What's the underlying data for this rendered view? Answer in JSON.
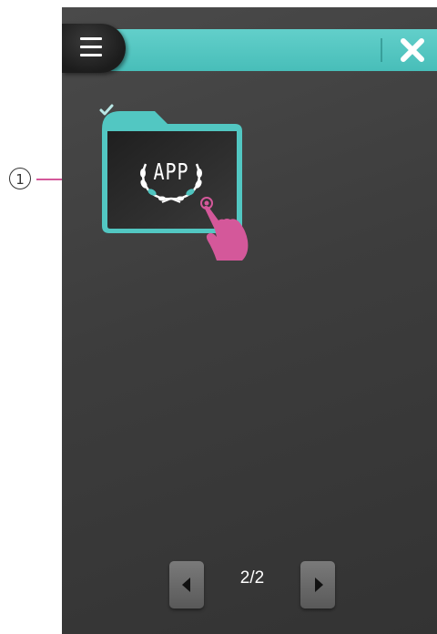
{
  "callout": {
    "number": "1"
  },
  "header": {
    "menu_icon": "hamburger-menu-icon",
    "close_icon": "close-x-icon",
    "accent_color": "#4fc4bf"
  },
  "folder": {
    "selected": true,
    "check_icon": "checkmark-icon",
    "logo_text": "APP",
    "logo_icon": "laurel-wreath-icon"
  },
  "pointer": {
    "icon": "tapping-hand-icon",
    "color": "#d4589a"
  },
  "pagination": {
    "prev_icon": "triangle-left-icon",
    "next_icon": "triangle-right-icon",
    "page_label": "2/2"
  }
}
